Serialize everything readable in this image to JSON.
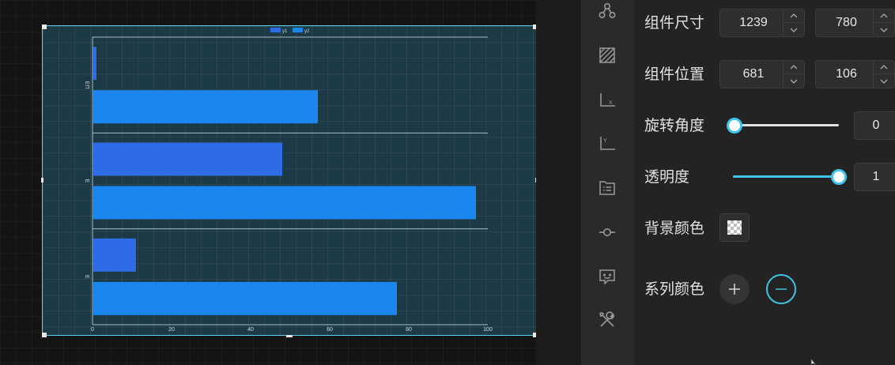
{
  "chart_data": {
    "type": "bar",
    "orientation": "horizontal",
    "categories": [
      "ΕΠ",
      "Ε",
      "Ε"
    ],
    "series": [
      {
        "name": "y1",
        "color": "#2d6ce6",
        "values": [
          1,
          48,
          11
        ]
      },
      {
        "name": "y2",
        "color": "#1a86ee",
        "values": [
          57,
          97,
          77
        ]
      }
    ],
    "xticks": [
      "0",
      "20",
      "40",
      "60",
      "80",
      "100"
    ],
    "xlim": [
      0,
      100
    ],
    "grid": true,
    "legend": "top-center"
  },
  "props": {
    "size": {
      "label": "组件尺寸",
      "width": "1239",
      "height": "780"
    },
    "position": {
      "label": "组件位置",
      "x": "681",
      "y": "106"
    },
    "rotation": {
      "label": "旋转角度",
      "value": "0",
      "level": 0
    },
    "opacity": {
      "label": "透明度",
      "value": "1",
      "level": 1
    },
    "background": {
      "label": "背景颜色"
    },
    "series_colors": {
      "label": "系列颜色"
    }
  },
  "toolbar": {
    "icons": [
      "graph-icon",
      "texture-icon",
      "x-axis-icon",
      "y-axis-icon",
      "legend-icon",
      "series-point-icon",
      "tooltip-icon",
      "tools-icon"
    ]
  },
  "colors": {
    "accent": "#3fc3e6",
    "selection": "#5ad0ea",
    "bar_y1": "#2d6ce6",
    "bar_y2": "#1a86ee"
  }
}
